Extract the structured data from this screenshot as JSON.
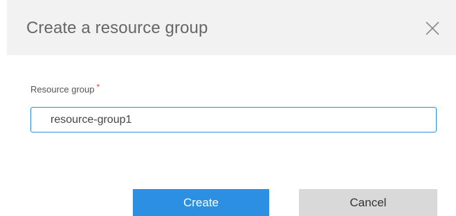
{
  "dialog": {
    "title": "Create a resource group",
    "close_icon": "close-icon"
  },
  "form": {
    "resource_group": {
      "label": "Resource group",
      "required_marker": "*",
      "value": "resource-group1"
    }
  },
  "actions": {
    "create_label": "Create",
    "cancel_label": "Cancel"
  },
  "colors": {
    "primary": "#2d8fe2",
    "header_bg": "#f2f2f2",
    "cancel_bg": "#d9d9d9",
    "required": "#e53935"
  }
}
